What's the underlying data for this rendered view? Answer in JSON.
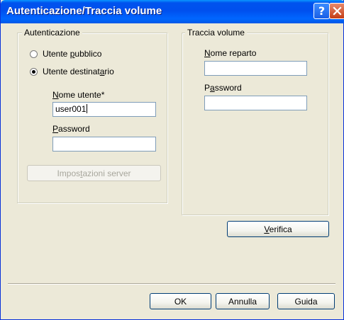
{
  "window": {
    "title": "Autenticazione/Traccia volume"
  },
  "titlebar_buttons": {
    "help_glyph": "?",
    "help_icon": "help-icon",
    "close_icon": "close-icon"
  },
  "auth_group": {
    "title": "Autenticazione",
    "radio_public": {
      "pre": "Utente ",
      "key": "p",
      "post": "ubblico",
      "checked": false
    },
    "radio_recipient": {
      "pre": "Utente destinat",
      "key": "a",
      "post": "rio",
      "checked": true
    },
    "username_label": {
      "key": "N",
      "post": "ome utente*"
    },
    "username_value": "user001",
    "password_label": {
      "key": "P",
      "post": "assword"
    },
    "password_value": "",
    "server_button": {
      "pre": "Impos",
      "key": "t",
      "post": "azioni server"
    }
  },
  "volume_group": {
    "title": "Traccia volume",
    "dept_label": {
      "key": "N",
      "post": "ome reparto"
    },
    "dept_value": "",
    "password_label": {
      "pre": "P",
      "key": "a",
      "post": "ssword"
    },
    "password_value": "",
    "verify_button": {
      "key": "V",
      "post": "erifica"
    }
  },
  "footer": {
    "ok": "OK",
    "cancel": "Annulla",
    "help": "Guida"
  }
}
